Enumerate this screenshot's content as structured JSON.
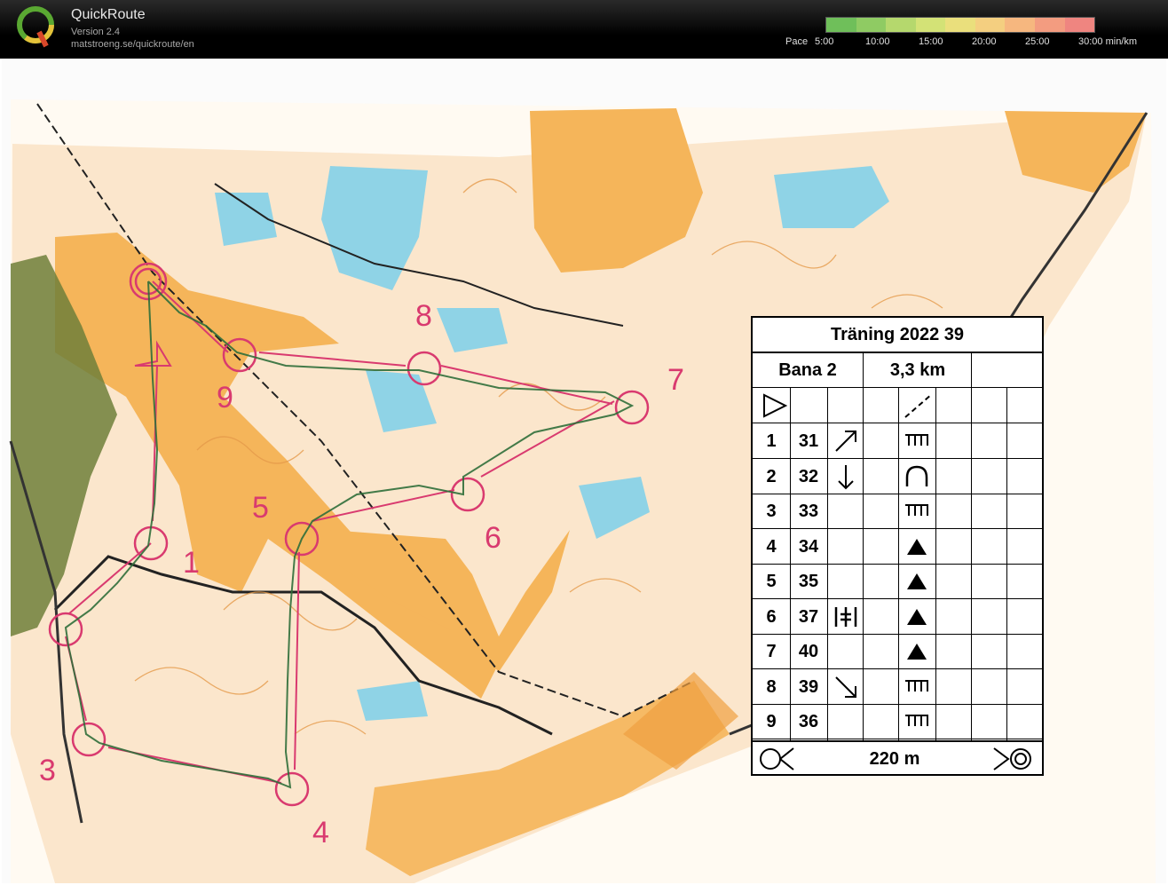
{
  "app": {
    "title": "QuickRoute",
    "version": "Version 2.4",
    "url": "matstroeng.se/quickroute/en"
  },
  "pace": {
    "label": "Pace",
    "ticks": [
      "5:00",
      "10:00",
      "15:00",
      "20:00",
      "25:00",
      "30:00  min/km"
    ],
    "colors": [
      "#6fbf5a",
      "#8fcb63",
      "#b5d86d",
      "#d3e276",
      "#eadf7c",
      "#f4cf80",
      "#f6b77f",
      "#f39c80",
      "#ef8580"
    ]
  },
  "map": {
    "controls": [
      {
        "num": "1"
      },
      {
        "num": "2"
      },
      {
        "num": "3"
      },
      {
        "num": "4"
      },
      {
        "num": "5"
      },
      {
        "num": "6"
      },
      {
        "num": "7"
      },
      {
        "num": "8"
      },
      {
        "num": "9"
      }
    ],
    "colors": {
      "orange": "#f5b55a",
      "light_orange": "#fbe3c4",
      "blue": "#5cc3dc",
      "magenta": "#d93a6f",
      "green": "#7cc47a",
      "route": "#2f6e3a"
    }
  },
  "description": {
    "title": "Träning 2022 39",
    "course": "Bana 2",
    "length": "3,3 km",
    "rows": [
      {
        "seq": "1",
        "code": "31",
        "dir": "↗",
        "feature": "ditch-end"
      },
      {
        "seq": "2",
        "code": "32",
        "dir": "↓",
        "feature": "ridge"
      },
      {
        "seq": "3",
        "code": "33",
        "dir": "",
        "feature": "ditch-end"
      },
      {
        "seq": "4",
        "code": "34",
        "dir": "",
        "feature": "boulder"
      },
      {
        "seq": "5",
        "code": "35",
        "dir": "",
        "feature": "boulder"
      },
      {
        "seq": "6",
        "code": "37",
        "dir": "|+|",
        "feature": "boulder"
      },
      {
        "seq": "7",
        "code": "40",
        "dir": "",
        "feature": "boulder"
      },
      {
        "seq": "8",
        "code": "39",
        "dir": "↘",
        "feature": "ditch-end"
      },
      {
        "seq": "9",
        "code": "36",
        "dir": "",
        "feature": "ditch-end"
      }
    ],
    "finish_distance": "220 m"
  }
}
